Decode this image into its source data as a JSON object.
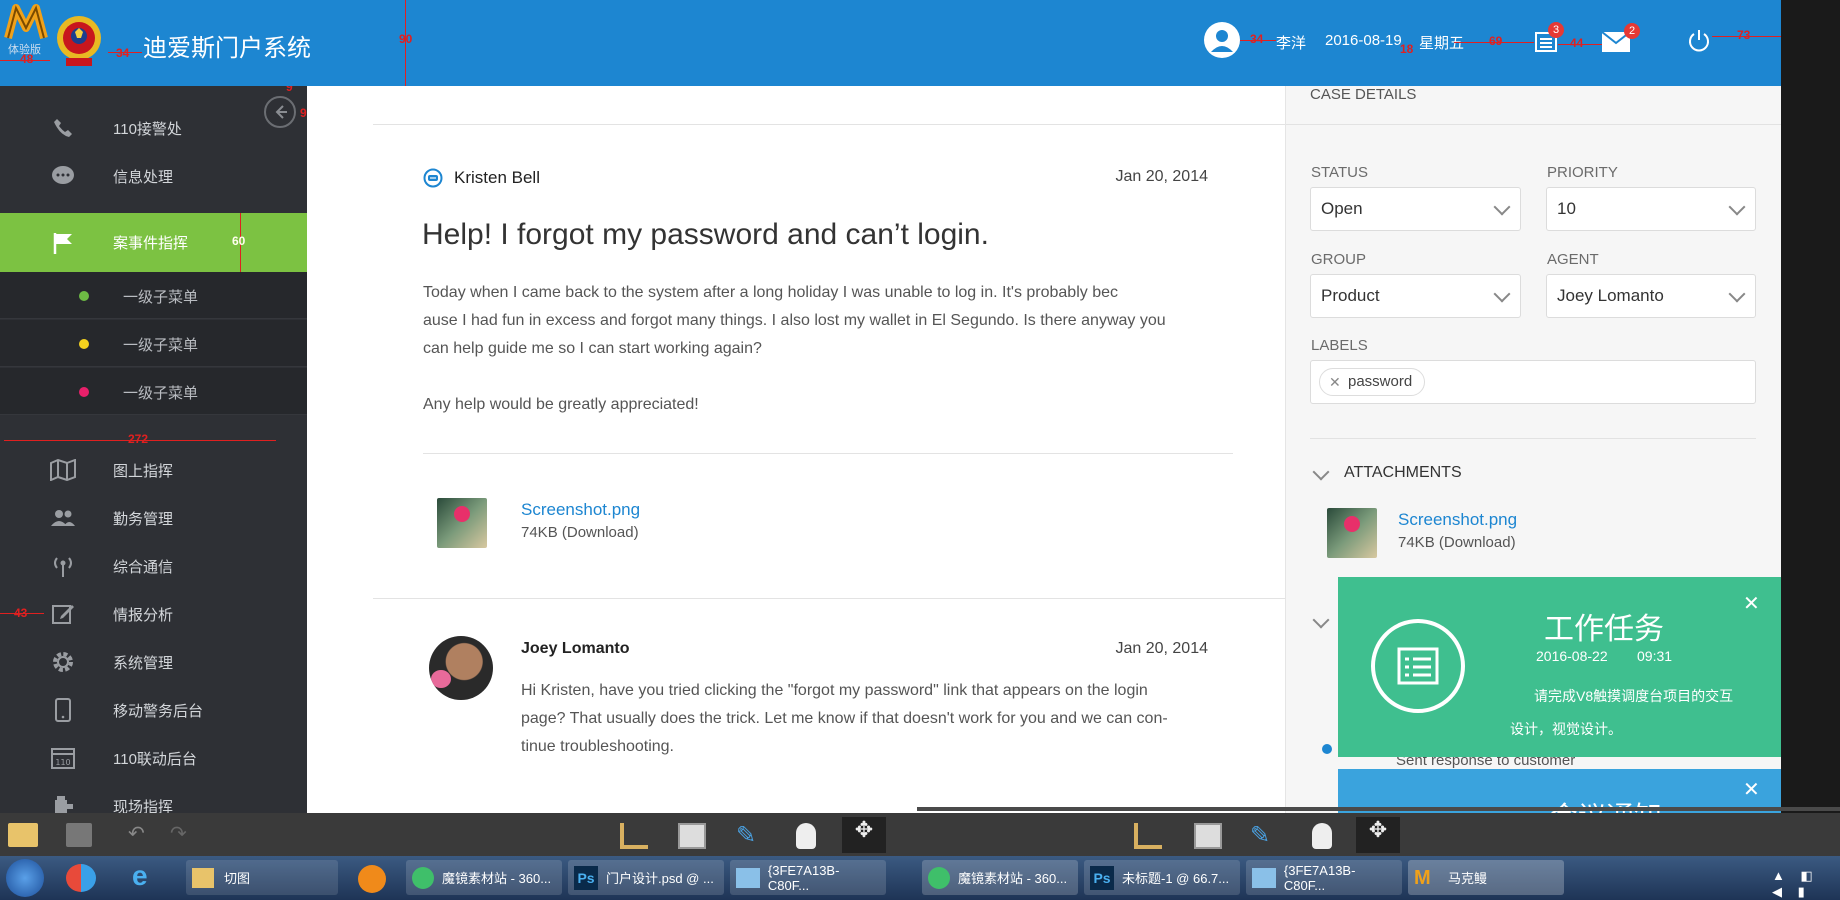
{
  "header": {
    "logo_badge": "体验版",
    "title": "迪爱斯门户系统",
    "user_name": "李洋",
    "date": "2016-08-19",
    "weekday": "星期五",
    "task_count": "3",
    "mail_count": "2"
  },
  "measure": {
    "m90": "90",
    "m34a": "34",
    "m48": "48",
    "m34b": "34",
    "m9a": "9",
    "m9b": "9",
    "m18": "18",
    "m69": "69",
    "m44": "44",
    "m73": "73",
    "m60": "60",
    "m272": "272",
    "m43": "43"
  },
  "sidebar": {
    "items": [
      {
        "label": "110接警处"
      },
      {
        "label": "信息处理"
      },
      {
        "label": "案事件指挥"
      },
      {
        "label": "图上指挥"
      },
      {
        "label": "勤务管理"
      },
      {
        "label": "综合通信"
      },
      {
        "label": "情报分析"
      },
      {
        "label": "系统管理"
      },
      {
        "label": "移动警务后台"
      },
      {
        "label": "110联动后台"
      },
      {
        "label": "现场指挥"
      }
    ],
    "subitems": [
      {
        "label": "一级子菜单",
        "dot": "#6dbb44"
      },
      {
        "label": "一级子菜单",
        "dot": "#f5d21e"
      },
      {
        "label": "一级子菜单",
        "dot": "#e8206a"
      }
    ]
  },
  "thread": {
    "msg1": {
      "author": "Kristen Bell",
      "date": "Jan 20, 2014",
      "subject": "Help! I forgot my password and can’t login.",
      "body1": "Today when I came back to the system after a long holiday I was unable to log in. It's probably bec",
      "body2": "ause I had fun in excess and forgot many things. I also lost my wallet in El Segundo. Is there anyway you",
      "body3": "can help guide me so I can start working again?",
      "body4": "Any help would be greatly appreciated!",
      "file_name": "Screenshot.png",
      "file_meta": "74KB (Download)"
    },
    "msg2": {
      "author": "Joey Lomanto",
      "date": "Jan 20, 2014",
      "body1": "Hi Kristen, have you tried clicking the \"forgot my password\" link that appears on the login",
      "body2": "page? That usually does the trick. Let me know if that doesn't work for you and we can con-",
      "body3": "tinue troubleshooting."
    }
  },
  "details": {
    "heading": "CASE DETAILS",
    "status_label": "STATUS",
    "status_value": "Open",
    "priority_label": "PRIORITY",
    "priority_value": "10",
    "group_label": "GROUP",
    "group_value": "Product",
    "agent_label": "AGENT",
    "agent_value": "Joey Lomanto",
    "labels_label": "LABELS",
    "tag": "password",
    "attachments_heading": "ATTACHMENTS",
    "file_name": "Screenshot.png",
    "file_meta": "74KB (Download)",
    "activity": "Sent response to customer"
  },
  "notification": {
    "title": "工作任务",
    "date": "2016-08-22",
    "time": "09:31",
    "text1": "请完成V8触摸调度台项目的交互",
    "text2": "设计，视觉设计。",
    "title2": "会议通知"
  },
  "taskbar": {
    "items": [
      {
        "label": "切图"
      },
      {
        "label": "魔镜素材站 - 360..."
      },
      {
        "label": "门户设计.psd @ ..."
      },
      {
        "label": "{3FE7A13B-C80F..."
      },
      {
        "label": "魔镜素材站 - 360..."
      },
      {
        "label": "未标题-1 @ 66.7..."
      },
      {
        "label": "{3FE7A13B-C80F..."
      },
      {
        "label": "马克鳗"
      }
    ]
  },
  "colors": {
    "header": "#1d86d1",
    "sidebar": "#2e3035",
    "active": "#7cc242",
    "notification": "#3fbf8f"
  }
}
